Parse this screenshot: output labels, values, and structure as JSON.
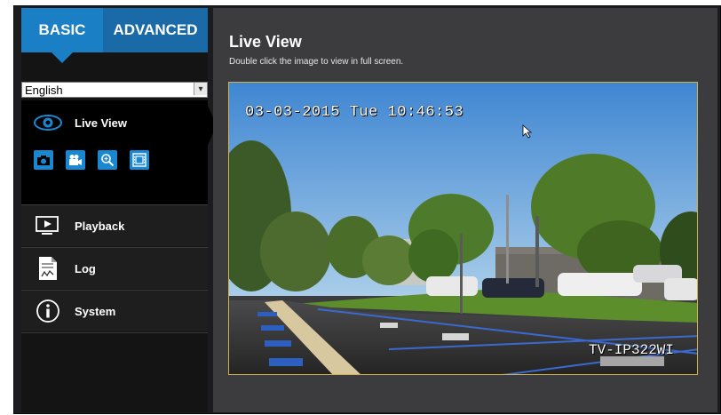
{
  "tabs": {
    "basic": "BASIC",
    "advanced": "ADVANCED"
  },
  "language": {
    "selected": "English"
  },
  "menu": {
    "live_view": "Live View",
    "playback": "Playback",
    "log": "Log",
    "system": "System"
  },
  "toolbar": {
    "icons": [
      "camera-icon",
      "video-record-icon",
      "zoom-icon",
      "film-icon"
    ]
  },
  "main": {
    "title": "Live View",
    "subtitle": "Double click the image to view in full screen."
  },
  "video": {
    "timestamp": "03-03-2015 Tue 10:46:53",
    "camera_name": "TV-IP322WI"
  },
  "colors": {
    "accent": "#1a7fc4",
    "tab_advanced": "#1a6aa8",
    "panel_bg": "#3c3c3e",
    "video_border": "#d2b24a"
  }
}
